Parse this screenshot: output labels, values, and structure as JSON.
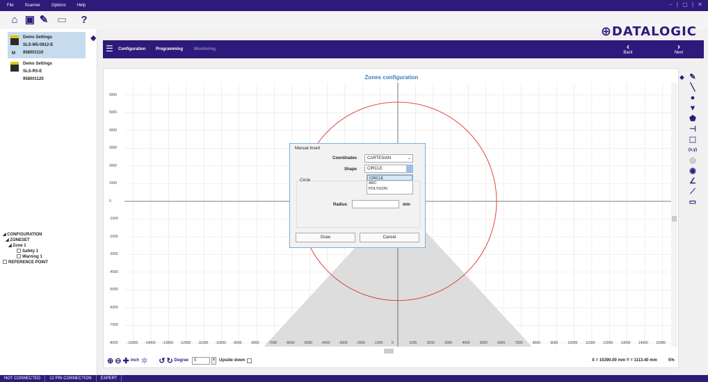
{
  "menu": [
    "File",
    "Scanner",
    "Options",
    "Help"
  ],
  "window_controls": "– | ▢ | ✕",
  "logo": "⊕DATALOGIC",
  "devices": [
    {
      "name": "Demo Settings",
      "model": "SLS-M5-0812-E",
      "serial": "958001110",
      "badge": "M"
    },
    {
      "name": "Demo Settings",
      "model": "SLS-R5-E",
      "serial": "958001120"
    }
  ],
  "tree": {
    "configuration": "◢ CONFIGURATION",
    "zoneset": "◢ ZONESET",
    "zone1": "◢ Zone 1",
    "safety": "Safety 1",
    "warning": "Warning 1",
    "reference": "REFERENCE POINT"
  },
  "nav": {
    "tabs": [
      "Configuration",
      "Programming",
      "Monitoring"
    ],
    "back": "Back",
    "next": "Next"
  },
  "plot_title": "Zones configuration",
  "chart_data": {
    "type": "scatter",
    "y_ticks": [
      "6000",
      "5000",
      "4000",
      "3000",
      "2000",
      "1000",
      "0",
      "-1000",
      "-2000",
      "-3000",
      "-4000",
      "-5000",
      "-6000",
      "-7000",
      "-8000"
    ],
    "x_ticks": [
      "-15000",
      "-14000",
      "-13000",
      "-12000",
      "-11000",
      "-10000",
      "-9000",
      "-8000",
      "-7000",
      "-6000",
      "-5000",
      "-4000",
      "-3000",
      "-2000",
      "-1000",
      "0",
      "1000",
      "2000",
      "3000",
      "4000",
      "5000",
      "6000",
      "7000",
      "8000",
      "9000",
      "10000",
      "11000",
      "12000",
      "13000",
      "14000",
      "15000"
    ],
    "xlim": [
      -15500,
      15500
    ],
    "ylim": [
      -8200,
      6700
    ],
    "circle": {
      "cx": 0,
      "cy": 0,
      "r": 5600,
      "color": "#e03030"
    },
    "field_of_view_color": "#d9d9d9"
  },
  "bottom": {
    "unit": "inch",
    "degree_label": "Degree",
    "degree_value": "0",
    "upside_down": "Upside down",
    "coords": "X = 15390.00 mm  Y = 1113.40 mm",
    "zoom": "5%"
  },
  "dialog": {
    "title": "Manual Insert",
    "coordinates_label": "Coordinates",
    "coordinates_value": "CARTESIAN",
    "shape_label": "Shape",
    "shape_value": "CIRCLE",
    "shape_options": [
      "CIRCLE",
      "ARC",
      "POLYGON"
    ],
    "group_title": "Circle",
    "radius_label": "Radius",
    "radius_value": "",
    "radius_unit": "mm",
    "draw": "Draw",
    "cancel": "Cancel"
  },
  "status": [
    "NOT CONNECTED",
    "12 PIN CONNECTION",
    "EXPERT"
  ]
}
